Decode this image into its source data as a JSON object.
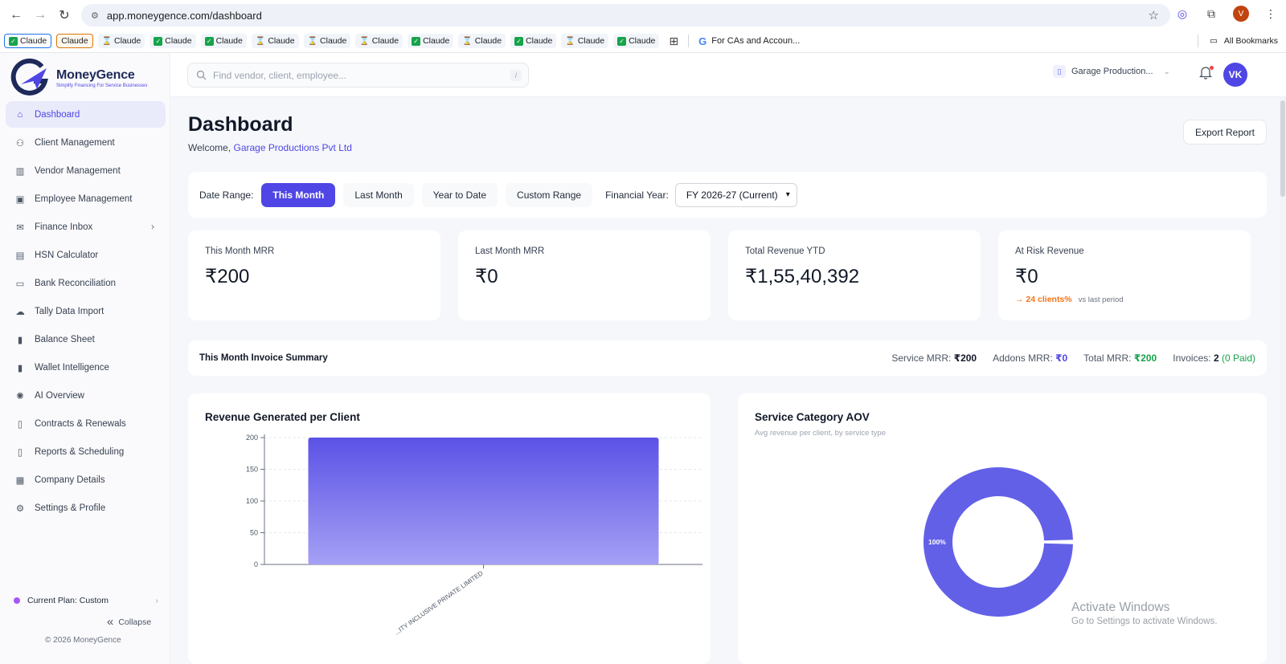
{
  "browser": {
    "url": "app.moneygence.com/dashboard",
    "profile_initial": "V",
    "bookmarks": [
      {
        "label": "Claude",
        "style": "outlined-blue",
        "icon": "check"
      },
      {
        "label": "Claude",
        "style": "outlined-orange",
        "icon": "none"
      },
      {
        "label": "Claude",
        "style": "plain",
        "icon": "hourglass"
      },
      {
        "label": "Claude",
        "style": "plain",
        "icon": "check"
      },
      {
        "label": "Claude",
        "style": "plain",
        "icon": "check"
      },
      {
        "label": "Claude",
        "style": "plain",
        "icon": "hourglass"
      },
      {
        "label": "Claude",
        "style": "plain",
        "icon": "hourglass"
      },
      {
        "label": "Claude",
        "style": "plain",
        "icon": "hourglass"
      },
      {
        "label": "Claude",
        "style": "plain",
        "icon": "check"
      },
      {
        "label": "Claude",
        "style": "plain",
        "icon": "hourglass"
      },
      {
        "label": "Claude",
        "style": "plain",
        "icon": "check"
      },
      {
        "label": "Claude",
        "style": "plain",
        "icon": "hourglass"
      },
      {
        "label": "Claude",
        "style": "plain",
        "icon": "check"
      }
    ],
    "bookmark_folder": "For CAs and Accoun...",
    "all_bookmarks": "All Bookmarks"
  },
  "brand": {
    "name": "MoneyGence",
    "tagline": "Simplify Financing For Service Businesses",
    "accent": "#4f46e5"
  },
  "sidebar": {
    "items": [
      {
        "label": "Dashboard",
        "icon": "home-icon",
        "active": true
      },
      {
        "label": "Client Management",
        "icon": "users-icon"
      },
      {
        "label": "Vendor Management",
        "icon": "building-icon"
      },
      {
        "label": "Employee Management",
        "icon": "briefcase-icon"
      },
      {
        "label": "Finance Inbox",
        "icon": "inbox-icon",
        "has_chevron": true
      },
      {
        "label": "HSN Calculator",
        "icon": "clipboard-icon"
      },
      {
        "label": "Bank Reconciliation",
        "icon": "card-icon"
      },
      {
        "label": "Tally Data Import",
        "icon": "upload-cloud-icon"
      },
      {
        "label": "Balance Sheet",
        "icon": "bar-chart-icon"
      },
      {
        "label": "Wallet Intelligence",
        "icon": "bar-chart-icon"
      },
      {
        "label": "AI Overview",
        "icon": "lightbulb-icon"
      },
      {
        "label": "Contracts & Renewals",
        "icon": "file-icon"
      },
      {
        "label": "Reports & Scheduling",
        "icon": "file-chart-icon"
      },
      {
        "label": "Company Details",
        "icon": "office-icon"
      },
      {
        "label": "Settings & Profile",
        "icon": "gear-icon"
      }
    ],
    "plan": "Current Plan: Custom",
    "collapse": "Collapse",
    "copyright": "© 2026 MoneyGence"
  },
  "header": {
    "search_placeholder": "Find vendor, client, employee...",
    "search_shortcut": "/",
    "company": "Garage Production...",
    "avatar": "VK"
  },
  "page": {
    "title": "Dashboard",
    "welcome": "Welcome,",
    "company_name": "Garage Productions Pvt Ltd",
    "export": "Export Report"
  },
  "filters": {
    "label": "Date Range:",
    "options": [
      {
        "label": "This Month",
        "active": true
      },
      {
        "label": "Last Month"
      },
      {
        "label": "Year to Date"
      },
      {
        "label": "Custom Range"
      }
    ],
    "fy_label": "Financial Year:",
    "fy_value": "FY 2026-27 (Current)"
  },
  "cards": [
    {
      "title": "This Month MRR",
      "value": "₹200"
    },
    {
      "title": "Last Month MRR",
      "value": "₹0"
    },
    {
      "title": "Total Revenue YTD",
      "value": "₹1,55,40,392"
    },
    {
      "title": "At Risk Revenue",
      "value": "₹0",
      "trend": "→ 24 clients%",
      "trend_note": "vs last period"
    }
  ],
  "summary": {
    "title": "This Month Invoice Summary",
    "service_label": "Service MRR:",
    "service_value": "₹200",
    "addons_label": "Addons MRR:",
    "addons_value": "₹0",
    "total_label": "Total MRR:",
    "total_value": "₹200",
    "invoices_label": "Invoices:",
    "invoices_value": "2",
    "invoices_paid": "(0 Paid)"
  },
  "chart_data": [
    {
      "type": "bar",
      "title": "Revenue Generated per Client",
      "categories": [
        "...ITY INCLUSIVE PRIVATE LIMITED"
      ],
      "values": [
        200
      ],
      "ylim": [
        0,
        200
      ],
      "yticks": [
        0,
        50,
        100,
        150,
        200
      ],
      "grid": true,
      "color_top": "#5b52e6",
      "color_bottom": "#a5a0f5"
    },
    {
      "type": "pie",
      "title": "Service Category AOV",
      "subtitle": "Avg revenue per client, by service type",
      "values": [
        100
      ],
      "labels": [
        "100%"
      ],
      "donut": true,
      "color": "#6360e8"
    }
  ],
  "watermark": {
    "line1": "Activate Windows",
    "line2": "Go to Settings to activate Windows."
  }
}
